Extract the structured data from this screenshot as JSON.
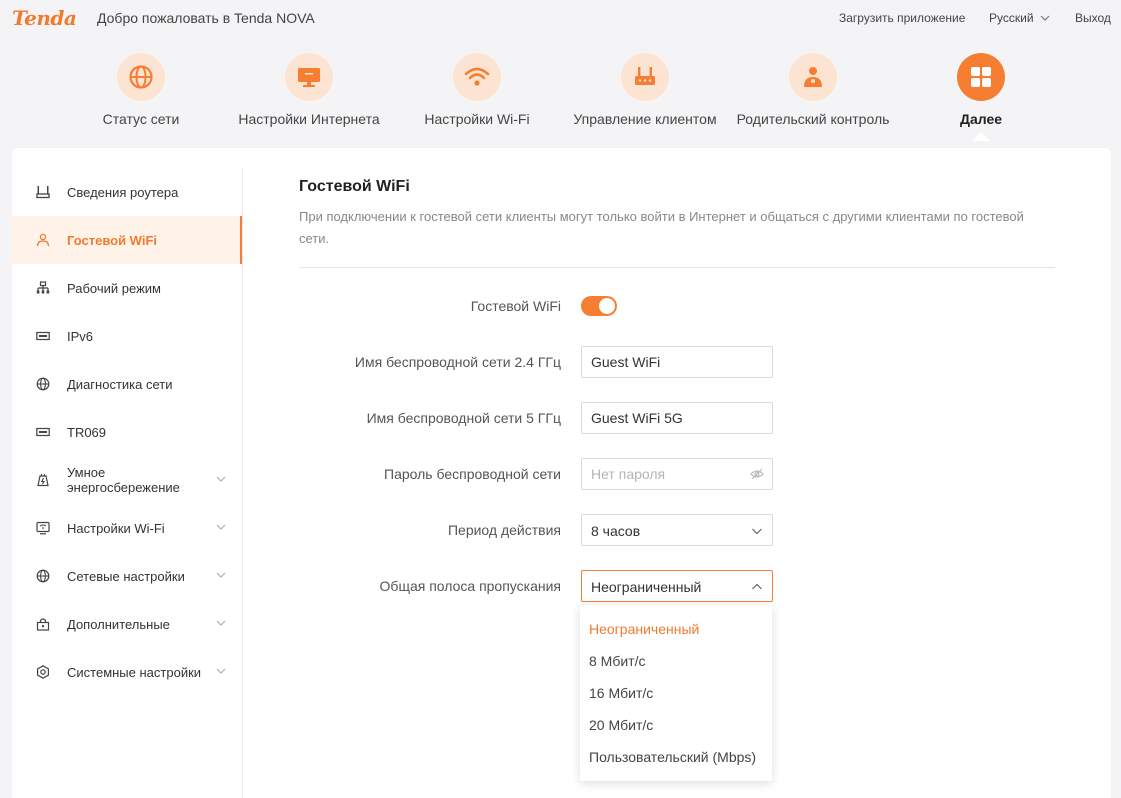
{
  "header": {
    "logo": "Tenda",
    "welcome": "Добро пожаловать в Tenda NOVA",
    "download_app": "Загрузить приложение",
    "language": "Русский",
    "logout": "Выход"
  },
  "nav": {
    "items": [
      {
        "label": "Статус сети",
        "icon": "globe-icon"
      },
      {
        "label": "Настройки Интернета",
        "icon": "monitor-icon"
      },
      {
        "label": "Настройки Wi-Fi",
        "icon": "wifi-icon"
      },
      {
        "label": "Управление клиентом",
        "icon": "router-icon"
      },
      {
        "label": "Родительский контроль",
        "icon": "parent-icon"
      },
      {
        "label": "Далее",
        "icon": "grid-icon",
        "active": true
      }
    ]
  },
  "sidebar": {
    "items": [
      {
        "label": "Сведения роутера",
        "icon": "router-info-icon"
      },
      {
        "label": "Гостевой WiFi",
        "icon": "guest-icon",
        "active": true
      },
      {
        "label": "Рабочий режим",
        "icon": "hierarchy-icon"
      },
      {
        "label": "IPv6",
        "icon": "ipv6-icon"
      },
      {
        "label": "Диагностика сети",
        "icon": "globe-icon"
      },
      {
        "label": "TR069",
        "icon": "tr069-icon"
      },
      {
        "label_line1": "Умное",
        "label_line2": "энергосбережение",
        "icon": "energy-icon",
        "expandable": true
      },
      {
        "label": "Настройки Wi-Fi",
        "icon": "wifi-settings-icon",
        "expandable": true
      },
      {
        "label": "Сетевые настройки",
        "icon": "network-globe-icon",
        "expandable": true
      },
      {
        "label": "Дополнительные",
        "icon": "lock-icon",
        "expandable": true
      },
      {
        "label": "Системные настройки",
        "icon": "gear-icon",
        "expandable": true
      }
    ]
  },
  "content": {
    "title": "Гостевой WiFi",
    "description": "При подключении к гостевой сети клиенты могут только войти в Интернет и общаться с другими клиентами по гостевой сети.",
    "form": {
      "guest_wifi_label": "Гостевой WiFi",
      "guest_wifi_enabled": true,
      "ssid24_label": "Имя беспроводной сети 2.4 ГГц",
      "ssid24_value": "Guest WiFi",
      "ssid5_label": "Имя беспроводной сети 5 ГГц",
      "ssid5_value": "Guest WiFi 5G",
      "password_label": "Пароль беспроводной сети",
      "password_placeholder": "Нет пароля",
      "period_label": "Период действия",
      "period_value": "8 часов",
      "bandwidth_label": "Общая полоса пропускания",
      "bandwidth_value": "Неограниченный",
      "bandwidth_options": [
        "Неограниченный",
        "8 Мбит/с",
        "16 Мбит/с",
        "20 Мбит/с",
        "Пользовательский (Mbps)"
      ]
    }
  },
  "colors": {
    "accent": "#f57e33",
    "accent_light": "#fde4d2",
    "active_bg": "#fff3e9"
  }
}
